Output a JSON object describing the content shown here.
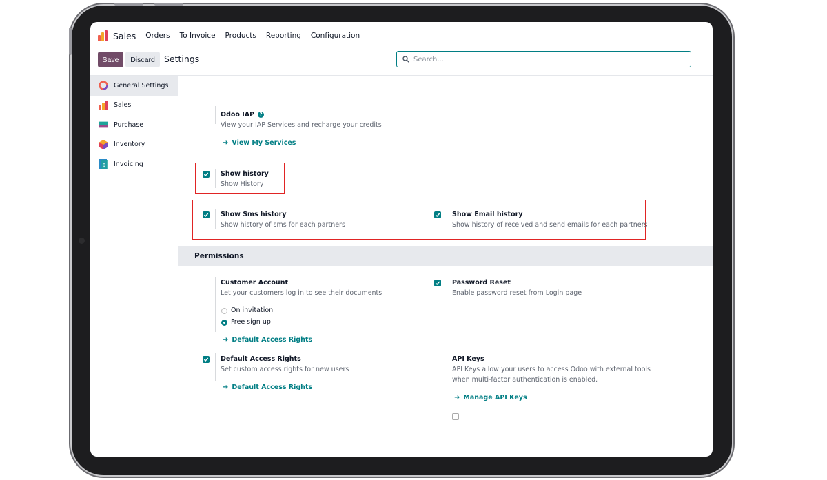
{
  "app": {
    "name": "Sales"
  },
  "nav": [
    "Orders",
    "To Invoice",
    "Products",
    "Reporting",
    "Configuration"
  ],
  "control": {
    "save_label": "Save",
    "discard_label": "Discard",
    "breadcrumb": "Settings",
    "search_placeholder": "Search..."
  },
  "sidebar": {
    "items": [
      {
        "label": "General Settings",
        "icon": "general-settings-icon",
        "active": true
      },
      {
        "label": "Sales",
        "icon": "sales-app-icon"
      },
      {
        "label": "Purchase",
        "icon": "purchase-app-icon"
      },
      {
        "label": "Inventory",
        "icon": "inventory-app-icon"
      },
      {
        "label": "Invoicing",
        "icon": "invoicing-app-icon"
      }
    ]
  },
  "settings": {
    "iap": {
      "title": "Odoo IAP",
      "desc": "View your IAP Services and recharge your credits",
      "link": "View My Services"
    },
    "show_history": {
      "title": "Show history",
      "desc": "Show History",
      "checked": true
    },
    "sms_history": {
      "title": "Show Sms history",
      "desc": "Show history of sms for each partners",
      "checked": true
    },
    "email_history": {
      "title": "Show Email history",
      "desc": "Show history of received and send emails for each partners",
      "checked": true
    }
  },
  "permissions": {
    "heading": "Permissions",
    "customer_account": {
      "title": "Customer Account",
      "desc": "Let your customers log in to see their documents",
      "options": [
        "On invitation",
        "Free sign up"
      ],
      "selected": "Free sign up",
      "link": "Default Access Rights"
    },
    "password_reset": {
      "title": "Password Reset",
      "desc": "Enable password reset from Login page",
      "checked": true
    },
    "default_access": {
      "title": "Default Access Rights",
      "desc": "Set custom access rights for new users",
      "link": "Default Access Rights",
      "checked": true
    },
    "api_keys": {
      "title": "API Keys",
      "desc_line1": "API Keys allow your users to access Odoo with external tools",
      "desc_line2": "when multi-factor authentication is enabled.",
      "link": "Manage API Keys"
    }
  },
  "colors": {
    "brand": "#714b67",
    "accent": "#017e84",
    "highlight": "#e02424"
  }
}
